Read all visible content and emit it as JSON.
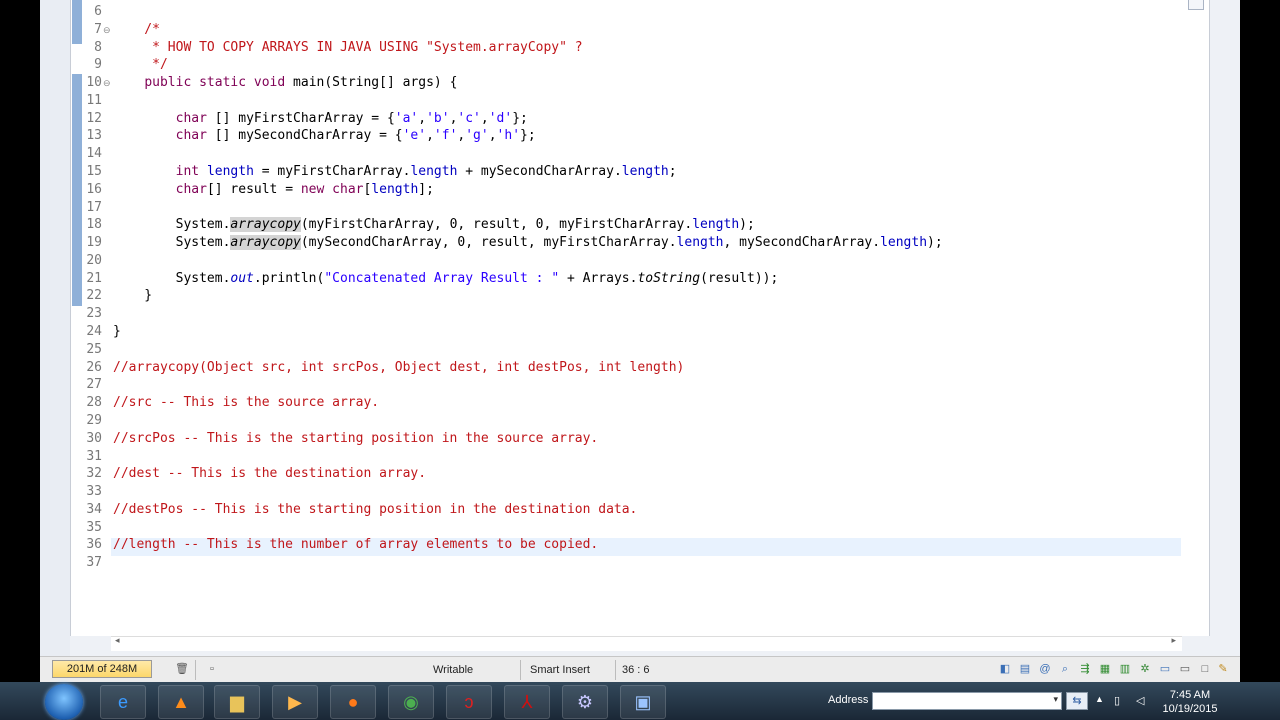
{
  "editor": {
    "lines": [
      {
        "n": "6",
        "code": ""
      },
      {
        "n": "7",
        "fold": "⊖",
        "code": "    /*"
      },
      {
        "n": "8",
        "code": "     * HOW TO COPY ARRAYS IN JAVA USING \"System.arrayCopy\" ?"
      },
      {
        "n": "9",
        "code": "     */"
      },
      {
        "n": "10",
        "fold": "⊖",
        "code": "    public static void main(String[] args) {"
      },
      {
        "n": "11",
        "code": ""
      },
      {
        "n": "12",
        "code": "        char [] myFirstCharArray = {'a','b','c','d'};"
      },
      {
        "n": "13",
        "code": "        char [] mySecondCharArray = {'e','f','g','h'};"
      },
      {
        "n": "14",
        "code": ""
      },
      {
        "n": "15",
        "code": "        int length = myFirstCharArray.length + mySecondCharArray.length;"
      },
      {
        "n": "16",
        "code": "        char[] result = new char[length];"
      },
      {
        "n": "17",
        "code": ""
      },
      {
        "n": "18",
        "code": "        System.arraycopy(myFirstCharArray, 0, result, 0, myFirstCharArray.length);"
      },
      {
        "n": "19",
        "code": "        System.arraycopy(mySecondCharArray, 0, result, myFirstCharArray.length, mySecondCharArray.length);"
      },
      {
        "n": "20",
        "code": ""
      },
      {
        "n": "21",
        "code": "        System.out.println(\"Concatenated Array Result : \" + Arrays.toString(result));"
      },
      {
        "n": "22",
        "code": "    }"
      },
      {
        "n": "23",
        "code": ""
      },
      {
        "n": "24",
        "code": "}"
      },
      {
        "n": "25",
        "code": ""
      },
      {
        "n": "26",
        "code": "//arraycopy(Object src, int srcPos, Object dest, int destPos, int length)"
      },
      {
        "n": "27",
        "code": ""
      },
      {
        "n": "28",
        "code": "//src -- This is the source array."
      },
      {
        "n": "29",
        "code": ""
      },
      {
        "n": "30",
        "code": "//srcPos -- This is the starting position in the source array."
      },
      {
        "n": "31",
        "code": ""
      },
      {
        "n": "32",
        "code": "//dest -- This is the destination array."
      },
      {
        "n": "33",
        "code": ""
      },
      {
        "n": "34",
        "code": "//destPos -- This is the starting position in the destination data."
      },
      {
        "n": "35",
        "code": ""
      },
      {
        "n": "36",
        "code": "//length -- This is the number of array elements to be copied."
      },
      {
        "n": "37",
        "code": ""
      }
    ],
    "top_partial": "p         up     "
  },
  "status": {
    "heap": "201M of 248M",
    "writable": "Writable",
    "insert_mode": "Smart Insert",
    "position": "36 : 6"
  },
  "taskbar": {
    "address_label": "Address",
    "time": "7:45 AM",
    "date": "10/19/2015"
  },
  "colors": {
    "keyword": "#7f0055",
    "comment": "#c0161a",
    "string": "#2a00ff",
    "field": "#0000c0"
  }
}
